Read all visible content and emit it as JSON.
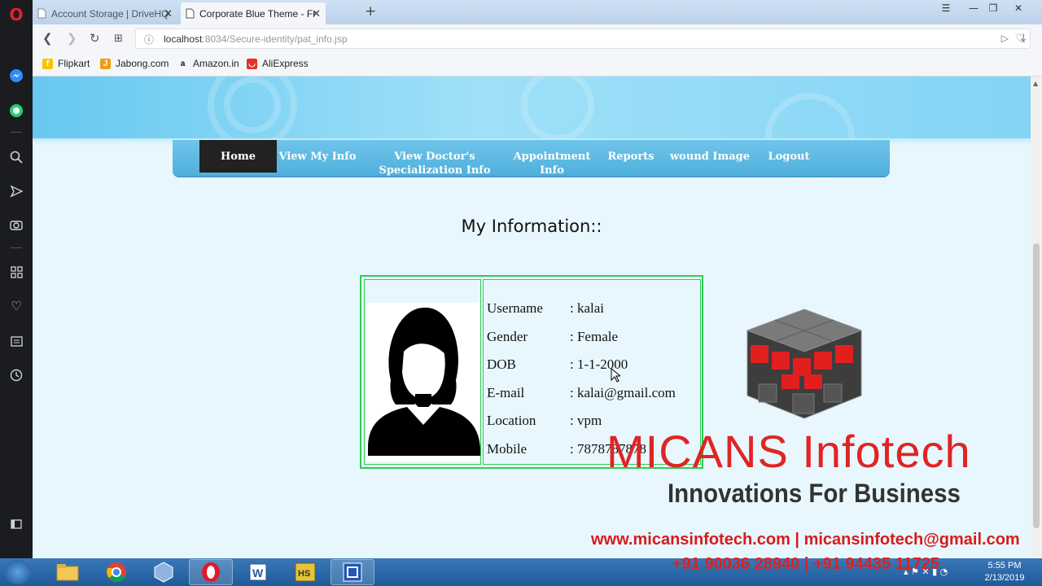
{
  "browser": {
    "tabs": [
      {
        "title": "Account Storage | DriveHQ",
        "active": false
      },
      {
        "title": "Corporate Blue Theme - Fr",
        "active": true
      }
    ],
    "url_host": "localhost",
    "url_rest": ":8034/Secure-identity/pat_info.jsp",
    "bookmarks": [
      "Flipkart",
      "Jabong.com",
      "Amazon.in",
      "AliExpress"
    ]
  },
  "nav": {
    "items": [
      "Home",
      "View My Info",
      "View Doctor's Specialization Info",
      "Appointment Info",
      "Reports",
      "wound Image",
      "Logout"
    ],
    "active": "Home"
  },
  "page": {
    "heading": "My Information::"
  },
  "profile": {
    "rows": [
      {
        "label": "Username",
        "value": ": kalai"
      },
      {
        "label": "Gender",
        "value": ": Female"
      },
      {
        "label": "DOB",
        "value": ": 1-1-2000"
      },
      {
        "label": "E-mail",
        "value": ": kalai@gmail.com"
      },
      {
        "label": "Location",
        "value": ": vpm"
      },
      {
        "label": "Mobile",
        "value": ": 7878787878"
      }
    ]
  },
  "watermark": {
    "title": "MICANS Infotech",
    "tagline": "Innovations For Business",
    "web": "www.micansinfotech.com | micansinfotech@gmail.com",
    "phone": "+91 90036 28940 | +91 94435 11725"
  },
  "taskbar": {
    "time": "5:55 PM",
    "date": "2/13/2019"
  },
  "colors": {
    "table_border": "#2ecc55",
    "nav_active": "#222222",
    "brand_red": "#e02424"
  }
}
